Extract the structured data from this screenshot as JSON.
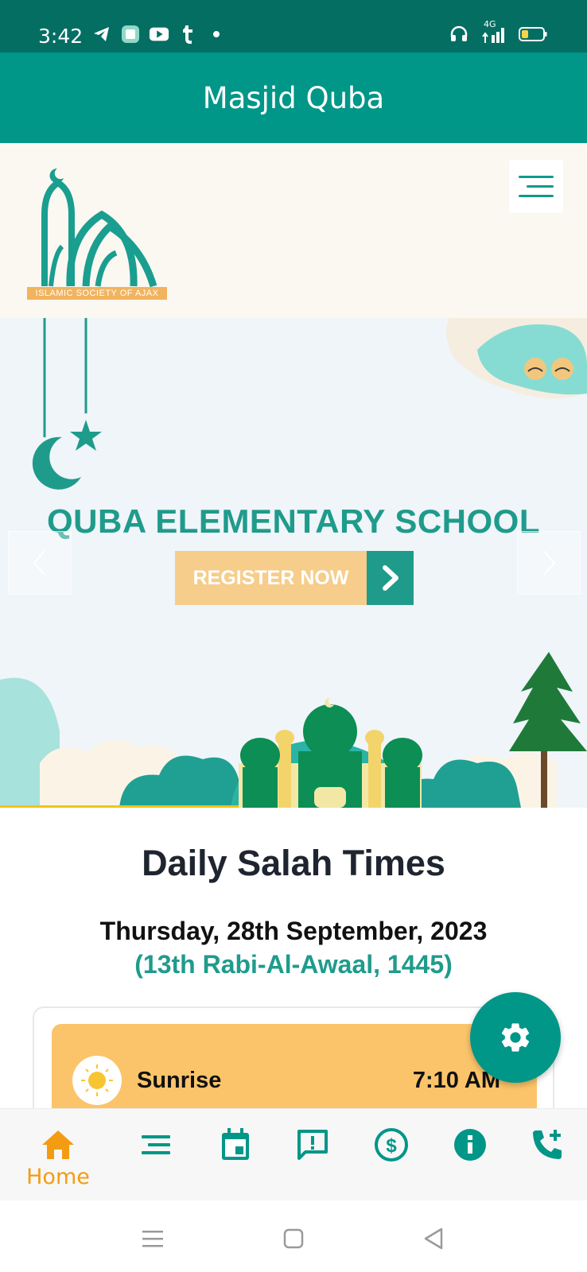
{
  "status_bar": {
    "time": "3:42",
    "network_label": "4G",
    "left_icons": [
      "telegram-icon",
      "app-icon",
      "youtube-icon",
      "tumblr-icon",
      "dot-icon"
    ],
    "right_icons": [
      "headset-icon",
      "signal-icon",
      "battery-icon"
    ],
    "battery_level": 0.25
  },
  "app_bar": {
    "title": "Masjid Quba"
  },
  "site_header": {
    "logo_text": "ISLAMIC SOCIETY OF AJAX",
    "menu_icon": "hamburger-menu-icon"
  },
  "banner": {
    "title": "QUBA ELEMENTARY SCHOOL",
    "register_label": "REGISTER NOW",
    "prev_arrow": "chevron-left-icon",
    "next_arrow": "chevron-right-icon",
    "colors": {
      "teal": "#1f9b8c",
      "sand": "#f6cd8b"
    }
  },
  "salah": {
    "title": "Daily Salah Times",
    "gregorian_date": "Thursday, 28th September, 2023",
    "hijri_date": "(13th Rabi-Al-Awaal, 1445)",
    "rows": [
      {
        "name": "Sunrise",
        "time": "7:10 AM",
        "icon": "sun-icon"
      }
    ]
  },
  "fab": {
    "icon": "gear-icon"
  },
  "bottom_nav": {
    "items": [
      {
        "label": "Home",
        "icon": "home-icon",
        "active": true
      },
      {
        "label": "",
        "icon": "menu-icon"
      },
      {
        "label": "",
        "icon": "calendar-icon"
      },
      {
        "label": "",
        "icon": "feedback-icon"
      },
      {
        "label": "",
        "icon": "donate-dollar-icon"
      },
      {
        "label": "",
        "icon": "info-icon"
      },
      {
        "label": "",
        "icon": "phone-add-icon"
      }
    ],
    "active_color": "#f39c12",
    "icon_color": "#009688"
  },
  "system_nav": [
    "recent-apps-icon",
    "home-square-icon",
    "back-icon"
  ]
}
